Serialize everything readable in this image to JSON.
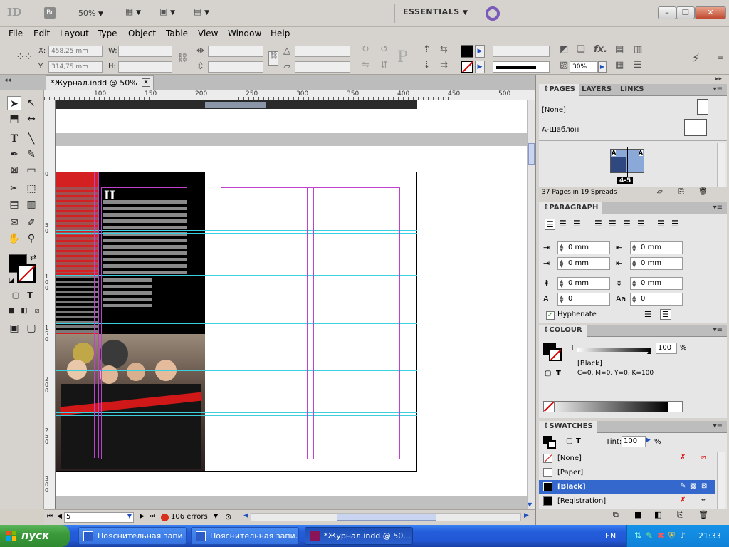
{
  "appbar": {
    "logo": "ID",
    "bridge": "Br",
    "zoom": "50%",
    "workspace": "ESSENTIALS",
    "window_buttons": {
      "min": "–",
      "restore": "❐",
      "close": "✕"
    }
  },
  "menu": [
    "File",
    "Edit",
    "Layout",
    "Type",
    "Object",
    "Table",
    "View",
    "Window",
    "Help"
  ],
  "control": {
    "x_label": "X:",
    "x_value": "458,25 mm",
    "y_label": "Y:",
    "y_value": "314,75 mm",
    "w_label": "W:",
    "h_label": "H:",
    "stroke_weight": "",
    "opacity": "30%"
  },
  "document": {
    "tab_title": "*Журнал.indd @ 50%",
    "hruler_ticks": [
      "100",
      "150",
      "200",
      "250",
      "300",
      "350",
      "400",
      "450",
      "500"
    ],
    "vruler_ticks": [
      "0",
      "5 0",
      "1 0 0",
      "1 5 0",
      "2 0 0",
      "2 5 0",
      "3 0 0"
    ],
    "page_number_field": "5",
    "preflight": "106 errors",
    "spread_letter": "II"
  },
  "panels": {
    "pages_tabs": [
      "PAGES",
      "LAYERS",
      "LINKS"
    ],
    "pages": {
      "none_label": "[None]",
      "master_label": "A-Шаблон",
      "spread_label": "4-5",
      "master_letter": "A",
      "summary": "37 Pages in 19 Spreads"
    },
    "paragraph": {
      "title": "PARAGRAPH",
      "left_indent": "0 mm",
      "right_indent": "0 mm",
      "first_line": "0 mm",
      "last_line": "0 mm",
      "space_before": "0 mm",
      "space_after": "0 mm",
      "drop_cap_lines": "0",
      "drop_cap_chars": "0",
      "hyphenate": "Hyphenate"
    },
    "colour": {
      "title": "COLOUR",
      "tint_label": "T",
      "tint_value": "100",
      "percent": "%",
      "swatch_name": "[Black]",
      "cmyk": "C=0, M=0, Y=0, K=100"
    },
    "swatches": {
      "title": "SWATCHES",
      "tint_label": "Tint:",
      "tint_value": "100",
      "percent": "%",
      "items": [
        "[None]",
        "[Paper]",
        "[Black]",
        "[Registration]"
      ]
    }
  },
  "taskbar": {
    "start": "пуск",
    "tasks": [
      "Пояснительная запи...",
      "Пояснительная запи...",
      "*Журнал.indd @ 50..."
    ],
    "lang": "EN",
    "clock": "21:33"
  }
}
